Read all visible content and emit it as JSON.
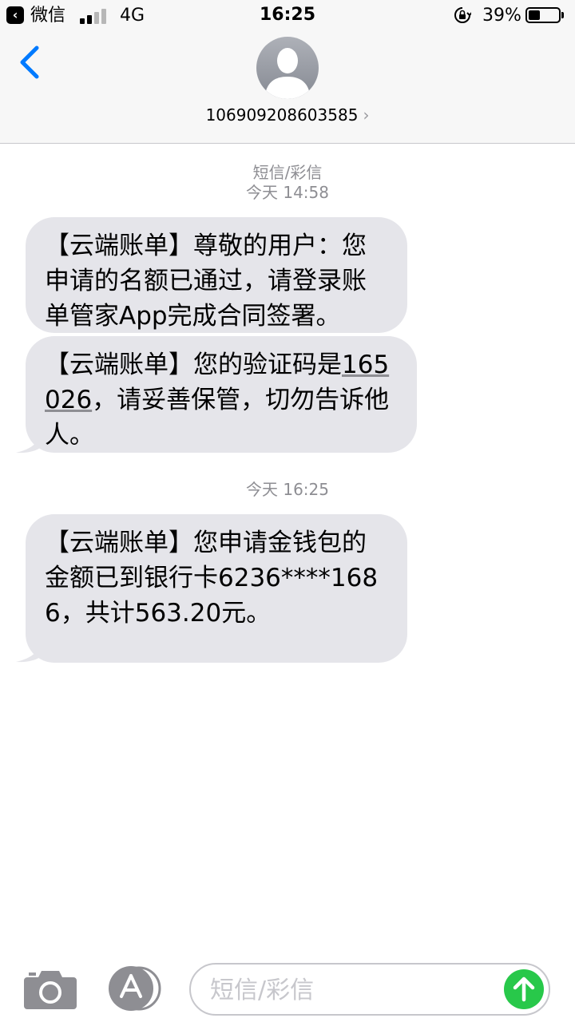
{
  "status_bar": {
    "back_app": "微信",
    "network": "4G",
    "time": "16:25",
    "battery_percent_label": "39%",
    "battery_level": 0.39
  },
  "header": {
    "contact": "106909208603585"
  },
  "messages": [
    {
      "meta_type": "短信/彩信",
      "meta_time": "今天 14:58",
      "bubbles": [
        "【云端账单】尊敬的用户：您申请的名额已通过，请登录账单管家App完成合同签署。",
        {
          "prefix": "【云端账单】您的验证码是",
          "code": "165026",
          "suffix": "，请妥善保管，切勿告诉他人。"
        }
      ]
    },
    {
      "meta_time": "今天 16:25",
      "bubbles": [
        "【云端账单】您申请金钱包的金额已到银行卡6236****1686，共计563.20元。"
      ]
    }
  ],
  "input": {
    "placeholder": "短信/彩信"
  },
  "colors": {
    "accent": "#007aff",
    "bubble": "#e5e5ea",
    "send": "#28c84a",
    "meta": "#8e8e93"
  },
  "icons": [
    "back-app-icon",
    "signal-icon",
    "orientation-lock-icon",
    "battery-icon",
    "back-chevron-icon",
    "avatar-icon",
    "camera-icon",
    "app-store-icon",
    "send-arrow-icon"
  ]
}
